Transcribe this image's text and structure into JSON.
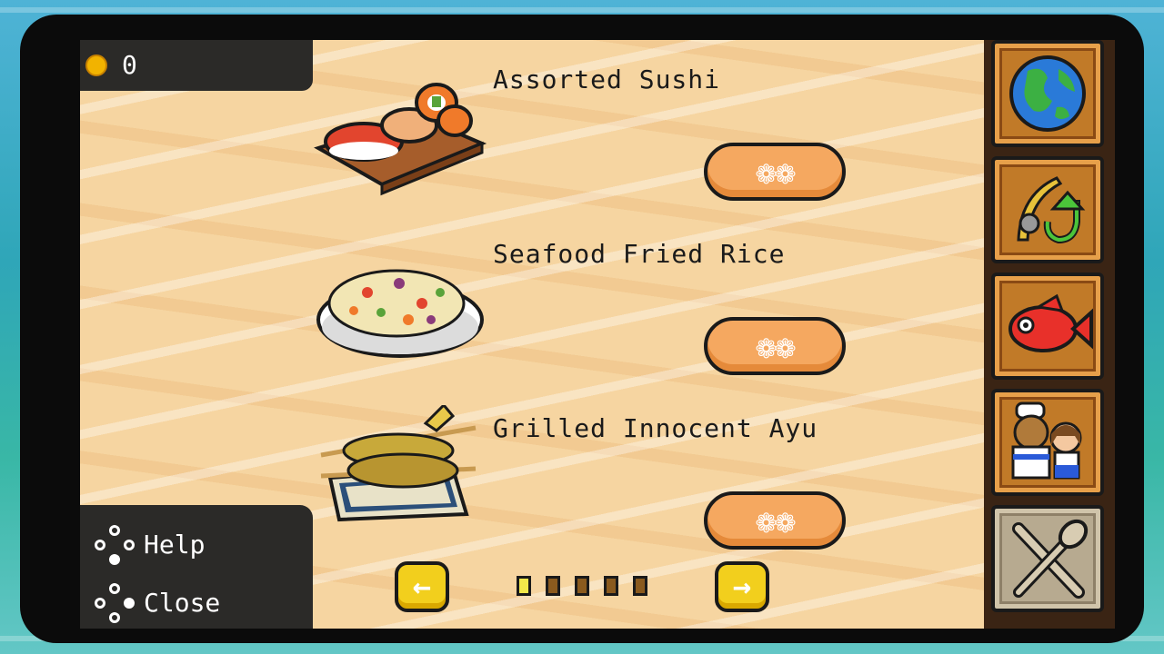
{
  "coins": {
    "count": "0"
  },
  "dishes": [
    {
      "name": "Assorted Sushi",
      "icon": "sushi-icon",
      "button": "🍴"
    },
    {
      "name": "Seafood Fried Rice",
      "icon": "fried-rice-icon",
      "button": "🍴"
    },
    {
      "name": "Grilled Innocent Ayu",
      "icon": "grilled-ayu-icon",
      "button": "🍴"
    }
  ],
  "eat_label": "❁❁",
  "controls": {
    "help": "Help",
    "close": "Close"
  },
  "pagination": {
    "prev": "←",
    "next": "→",
    "current_page": 1,
    "total_pages": 5
  },
  "sidebar": [
    {
      "icon": "globe-icon"
    },
    {
      "icon": "fishing-rod-upgrade-icon"
    },
    {
      "icon": "red-fish-icon"
    },
    {
      "icon": "crew-icon"
    },
    {
      "icon": "cutlery-x-icon"
    }
  ],
  "colors": {
    "panel": "#f6d5a1",
    "eat_button": "#f5a860",
    "arrow_button": "#f2cf1d",
    "sidebar_button": "#c17a28"
  }
}
